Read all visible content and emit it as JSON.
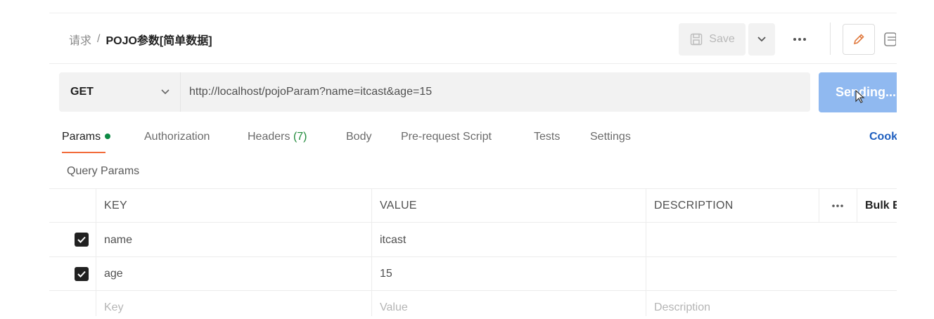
{
  "header": {
    "breadcrumb_parent": "请求",
    "breadcrumb_separator": "/",
    "breadcrumb_current": "POJO参数[简单数据]",
    "save_label": "Save"
  },
  "request": {
    "method": "GET",
    "url": "http://localhost/pojoParam?name=itcast&age=15",
    "send_label": "Sending..."
  },
  "tabs": [
    {
      "label": "Params",
      "active": true,
      "has_dot": true
    },
    {
      "label": "Authorization"
    },
    {
      "label": "Headers",
      "count": "(7)"
    },
    {
      "label": "Body"
    },
    {
      "label": "Pre-request Script"
    },
    {
      "label": "Tests"
    },
    {
      "label": "Settings"
    }
  ],
  "cookies_label": "Cookies",
  "query_params": {
    "title": "Query Params",
    "columns": {
      "key": "KEY",
      "value": "VALUE",
      "description": "DESCRIPTION",
      "bulk": "Bulk Edit"
    },
    "rows": [
      {
        "checked": true,
        "key": "name",
        "value": "itcast",
        "description": ""
      },
      {
        "checked": true,
        "key": "age",
        "value": "15",
        "description": ""
      }
    ],
    "placeholder": {
      "key": "Key",
      "value": "Value",
      "description": "Description"
    }
  },
  "colors": {
    "send_button": "#90b9f0",
    "accent_underline": "#f26b3a",
    "params_dot": "#0d8a44",
    "link": "#1f5fbf"
  },
  "icons": [
    "save-icon",
    "chevron-down-icon",
    "more-icon",
    "pencil-icon",
    "document-icon",
    "check-icon",
    "cursor-icon"
  ]
}
